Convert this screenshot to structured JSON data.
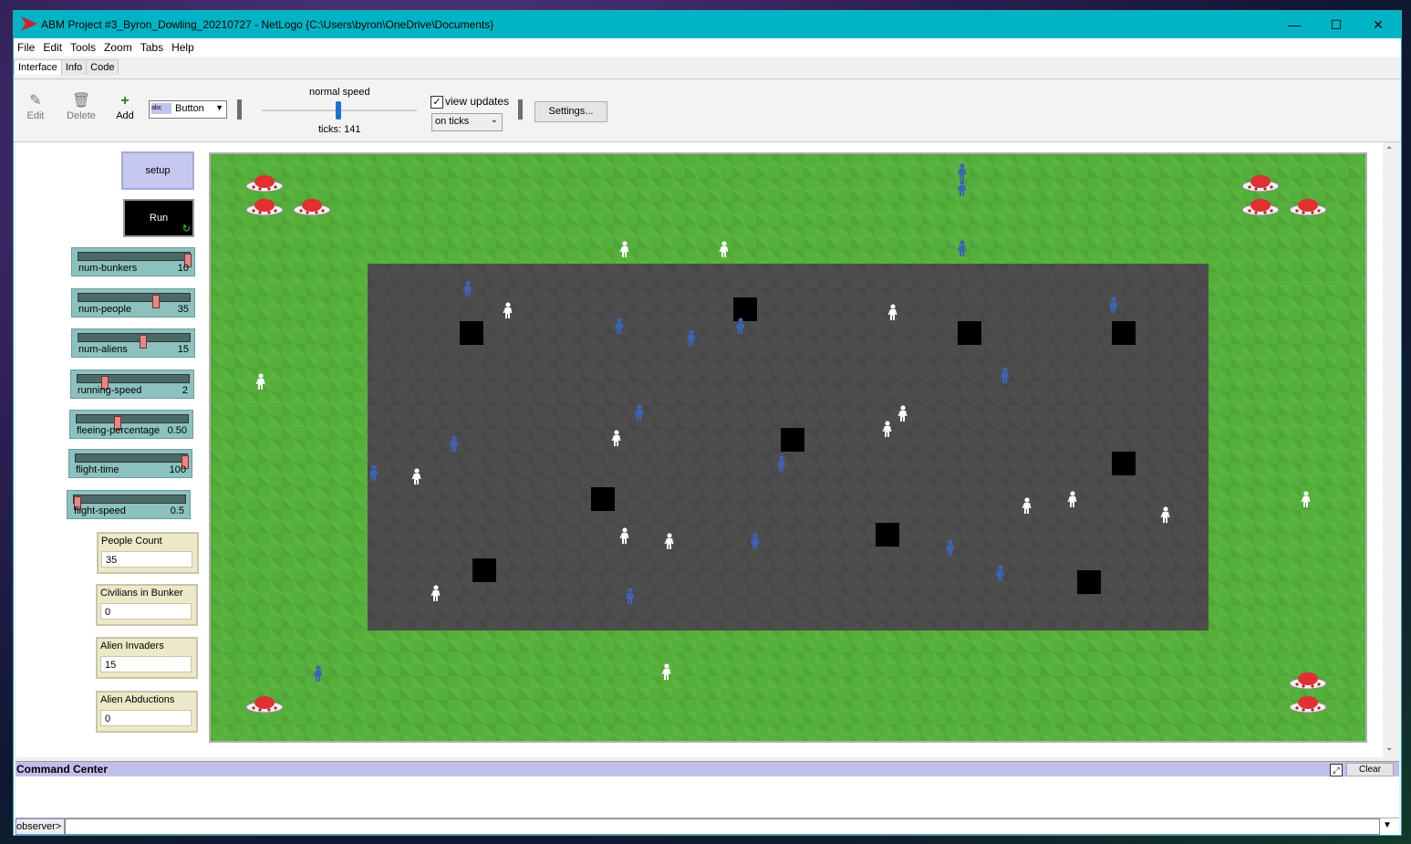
{
  "window": {
    "title": "ABM Project #3_Byron_Dowling_20210727 - NetLogo {C:\\Users\\byron\\OneDrive\\Documents}",
    "minimize": "—",
    "maximize": "☐",
    "close": "✕"
  },
  "menu": [
    "File",
    "Edit",
    "Tools",
    "Zoom",
    "Tabs",
    "Help"
  ],
  "tabs": [
    "Interface",
    "Info",
    "Code"
  ],
  "toolbar": {
    "edit_label": "Edit",
    "delete_label": "Delete",
    "add_label": "Add",
    "widget_type": "Button",
    "speed_label": "normal speed",
    "ticks_text": "ticks: 141",
    "view_updates_label": "view updates",
    "view_updates_checked": true,
    "update_mode": "on ticks",
    "settings_label": "Settings..."
  },
  "buttons": {
    "setup": "setup",
    "run": "Run"
  },
  "sliders": [
    {
      "name": "num-bunkers",
      "value": "10",
      "fraction": 1.0
    },
    {
      "name": "num-people",
      "value": "35",
      "fraction": 0.7
    },
    {
      "name": "num-aliens",
      "value": "15",
      "fraction": 0.58
    },
    {
      "name": "running-speed",
      "value": "2",
      "fraction": 0.22
    },
    {
      "name": "fleeing-percentage",
      "value": "0.50",
      "fraction": 0.35
    },
    {
      "name": "flight-time",
      "value": "100",
      "fraction": 1.0
    },
    {
      "name": "flight-speed",
      "value": "0.5",
      "fraction": 0.0
    }
  ],
  "monitors": [
    {
      "label": "People Count",
      "value": "35"
    },
    {
      "label": "Civilians in Bunker",
      "value": "0"
    },
    {
      "label": "Alien Invaders",
      "value": "15"
    },
    {
      "label": "Alien Abductions",
      "value": "0"
    }
  ],
  "colors": {
    "grass": "#54b03a",
    "street": "#4d4d4d",
    "civilian": "#ffffff",
    "fleeing_civilian": "#3d63b8",
    "ufo": "#e03030"
  },
  "command_center": {
    "title": "Command Center",
    "clear_label": "Clear",
    "prompt": "observer>"
  }
}
